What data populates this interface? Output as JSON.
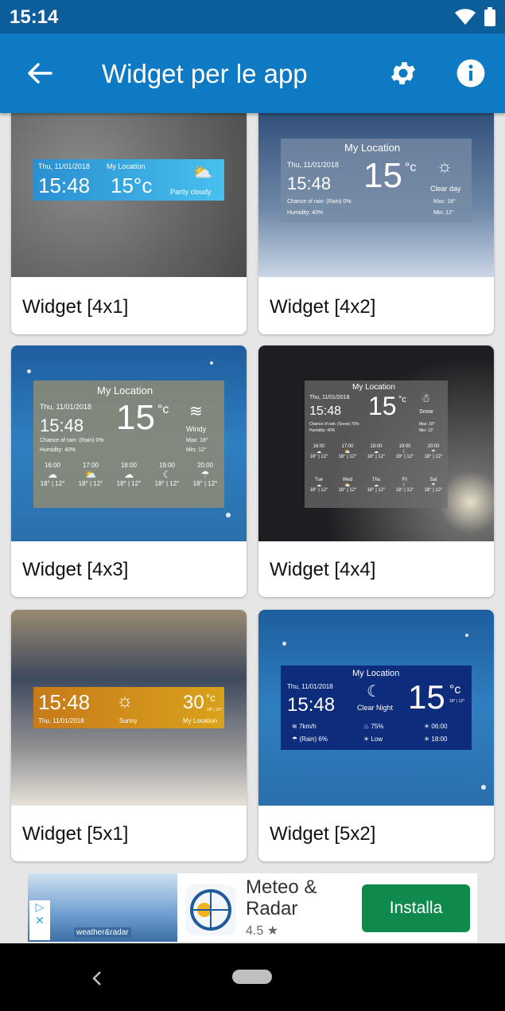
{
  "status_bar": {
    "time": "15:14"
  },
  "app_bar": {
    "title": "Widget per le app"
  },
  "icons": {
    "back": "arrow-left-icon",
    "settings": "gear-icon",
    "info": "info-icon"
  },
  "colors": {
    "app_bar": "#0e7ac4",
    "status_bar": "#0c5e9b",
    "install": "#0f8a4c"
  },
  "widgets": [
    {
      "label": "Widget [4x1]",
      "date": "Thu, 11/01/2018",
      "location": "My Location",
      "time": "15:48",
      "temp": "15°c",
      "condition": "Partly cloudy"
    },
    {
      "label": "Widget [4x2]",
      "date": "Thu, 11/01/2018",
      "location": "My Location",
      "time": "15:48",
      "temp": "15",
      "unit": "°c",
      "condition": "Clear day",
      "chance": "Chance of rain: (Rain) 0%",
      "humidity": "Humidity: 40%",
      "max": "Max: 18°",
      "min": "Min: 12°"
    },
    {
      "label": "Widget [4x3]",
      "date": "Thu, 11/01/2018",
      "location": "My Location",
      "time": "15:48",
      "temp": "15",
      "unit": "°c",
      "condition": "Windy",
      "chance": "Chance of rain: (Rain) 0%",
      "humidity": "Humidity: 40%",
      "max": "Max: 18°",
      "min": "Min: 12°",
      "hours": [
        "16:00",
        "17:00",
        "18:00",
        "19:00",
        "20:00"
      ],
      "hour_temp": "18° | 12°"
    },
    {
      "label": "Widget [4x4]",
      "date": "Thu, 11/01/2018",
      "location": "My Location",
      "time": "15:48",
      "temp": "15",
      "unit": "°c",
      "condition": "Snow",
      "chance": "Chance of rain: (Snow) 70%",
      "humidity": "Humidity: 40%",
      "max": "Max: 18°",
      "min": "Min: 12°",
      "hours": [
        "16:00",
        "17:00",
        "18:00",
        "19:00",
        "20:00"
      ],
      "days": [
        "Tue",
        "Wed",
        "Thu",
        "Fri",
        "Sat"
      ],
      "hour_temp": "18° | 12°"
    },
    {
      "label": "Widget [5x1]",
      "date": "Thu, 11/01/2018",
      "location": "My Location",
      "time": "15:48",
      "temp": "30",
      "unit": "°c",
      "sub": "18° | 12°",
      "condition": "Sunny"
    },
    {
      "label": "Widget [5x2]",
      "date": "Thu, 11/01/2018",
      "location": "My Location",
      "time": "15:48",
      "temp": "15",
      "unit": "°c",
      "sub": "18° | 12°",
      "condition": "Clear Night",
      "wind": "7km/h",
      "rain": "(Rain) 6%",
      "humidity": "75%",
      "uv": "Low",
      "sunrise": "06:00",
      "sunset": "18:00"
    }
  ],
  "ad": {
    "brand": "weather&radar",
    "title": "Meteo & Radar",
    "rating": "4.5 ★",
    "install": "Installa"
  }
}
